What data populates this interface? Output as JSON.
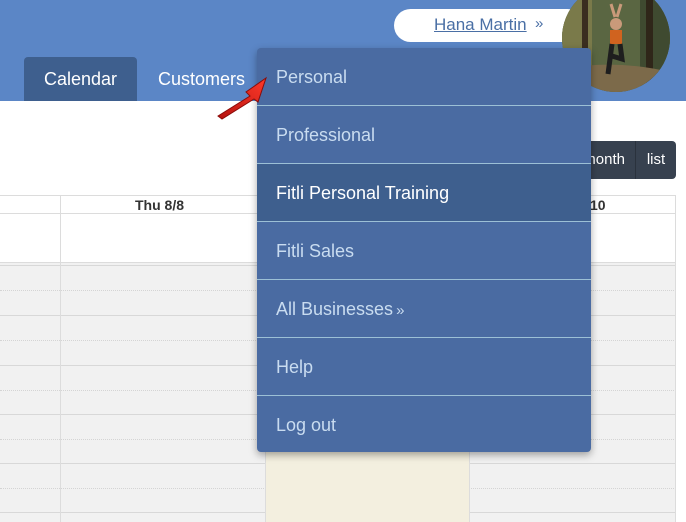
{
  "header": {
    "user_name": "Hana Martin",
    "tabs": [
      {
        "label": "Calendar"
      },
      {
        "label": "Customers"
      }
    ]
  },
  "view_buttons": {
    "month": "month",
    "list": "list"
  },
  "calendar": {
    "columns": [
      "Thu 8/8",
      "10"
    ]
  },
  "menu": {
    "items": [
      {
        "label": "Personal"
      },
      {
        "label": "Professional"
      },
      {
        "label": "Fitli Personal Training"
      },
      {
        "label": "Fitli Sales"
      },
      {
        "label": "All Businesses"
      },
      {
        "label": "Help"
      },
      {
        "label": "Log out"
      }
    ]
  },
  "colors": {
    "header": "#5b86c6",
    "menu": "#4a6ba2",
    "menu_active": "#3e5f8e",
    "annotation_arrow": "#e0201b"
  }
}
